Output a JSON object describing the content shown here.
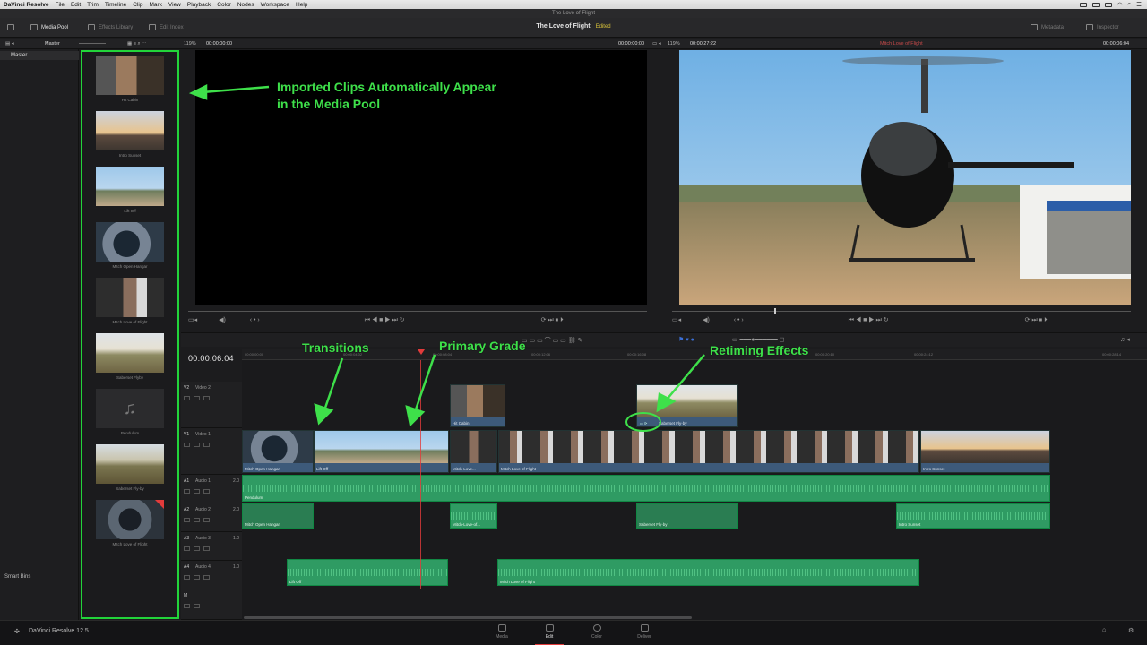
{
  "menubar": {
    "items": [
      "DaVinci Resolve",
      "File",
      "Edit",
      "Trim",
      "Timeline",
      "Clip",
      "Mark",
      "View",
      "Playback",
      "Color",
      "Nodes",
      "Workspace",
      "Help"
    ]
  },
  "window": {
    "title": "The Love of Flight"
  },
  "toolbar": {
    "media_pool": "Media Pool",
    "effects_library": "Effects Library",
    "edit_index": "Edit Index",
    "project_title": "The Love of Flight",
    "status": "Edited",
    "metadata": "Metadata",
    "inspector": "Inspector"
  },
  "subbar": {
    "bin": "Master",
    "src_zoom": "119%",
    "src_tc": "00:00:00:00",
    "src_tc2": "00:00:00:00",
    "tl_zoom": "119%",
    "tl_dur": "00:00:27:22",
    "tl_name": "Mitch Love of Flight",
    "tl_tc": "00:00:06:04"
  },
  "sidebar": {
    "header": "Master",
    "smart_bins": "Smart Bins"
  },
  "media_pool": {
    "clips": [
      {
        "label": "Hit Cabin"
      },
      {
        "label": "Intro Sunset"
      },
      {
        "label": "Lift Off"
      },
      {
        "label": "Mitch Open Hangar"
      },
      {
        "label": "Mitch Love of Flight"
      },
      {
        "label": "Saberset Flyby"
      },
      {
        "label": "Pendulum"
      },
      {
        "label": "Saberset Fly-by"
      },
      {
        "label": "Mitch Love of Flight"
      }
    ]
  },
  "timeline": {
    "timecode": "00:00:06:04",
    "ruler": [
      "00:00:00:00",
      "00:00:04:02",
      "00:00:08:04",
      "00:00:12:06",
      "00:00:16:08",
      "00:00:20:10",
      "00:00:24:12",
      "00:00:28:14"
    ],
    "tracks": [
      {
        "id": "V2",
        "name": "Video 2"
      },
      {
        "id": "V1",
        "name": "Video 1"
      },
      {
        "id": "A1",
        "name": "Audio 1",
        "ch": "2.0"
      },
      {
        "id": "A2",
        "name": "Audio 2",
        "ch": "2.0"
      },
      {
        "id": "A3",
        "name": "Audio 3",
        "ch": "1.0"
      },
      {
        "id": "A4",
        "name": "Audio 4",
        "ch": "1.0"
      },
      {
        "id": "M",
        "name": ""
      }
    ],
    "v2_clips": [
      "Hit Cabin",
      "Saberset Fly-by"
    ],
    "v1_clips": [
      "Mitch Open Hangar",
      "Lift Off",
      "Mitch-Love...",
      "Mitch Love of Flight",
      "Intro Sunset"
    ],
    "a1_clips": [
      "Pendulum"
    ],
    "a2_clips": [
      "Mitch Open Hangar",
      "Mitch-Love-of...",
      "Saberset Fly-by",
      "Intro Sunset"
    ],
    "a4_clips": [
      "Lift Off",
      "Mitch Love of Flight"
    ]
  },
  "annotations": {
    "media_pool": "Imported Clips Automatically Appear\nin the Media Pool",
    "transitions": "Transitions",
    "primary_grade": "Primary Grade",
    "retiming": "Retiming Effects"
  },
  "footer": {
    "app_name": "DaVinci Resolve 12.5",
    "pages": [
      "Media",
      "Edit",
      "Color",
      "Deliver"
    ]
  },
  "colors": {
    "annotation": "#3ee04a",
    "playhead": "#e23b3b",
    "video_clip": "#3d5a7a",
    "audio_clip": "#2f9b63"
  }
}
